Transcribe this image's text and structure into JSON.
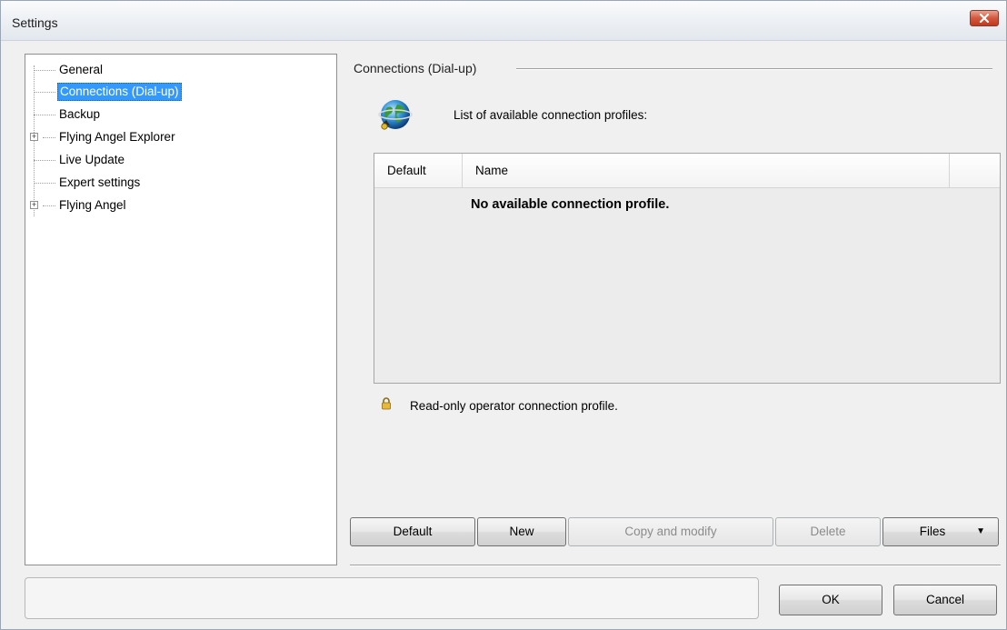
{
  "window": {
    "title": "Settings"
  },
  "tree": {
    "items": [
      {
        "label": "General",
        "selected": false,
        "expandable": false
      },
      {
        "label": "Connections (Dial-up)",
        "selected": true,
        "expandable": false
      },
      {
        "label": "Backup",
        "selected": false,
        "expandable": false
      },
      {
        "label": "Flying Angel Explorer",
        "selected": false,
        "expandable": true
      },
      {
        "label": "Live Update",
        "selected": false,
        "expandable": false
      },
      {
        "label": "Expert settings",
        "selected": false,
        "expandable": false
      },
      {
        "label": "Flying Angel",
        "selected": false,
        "expandable": true
      }
    ]
  },
  "panel": {
    "group_title": "Connections (Dial-up)",
    "list_caption": "List of available connection profiles:",
    "icon": "globe-network-icon",
    "columns": [
      "Default",
      "Name",
      ""
    ],
    "empty_message": "No available connection profile.",
    "legend_icon": "lock-icon",
    "legend_text": "Read-only operator connection profile."
  },
  "actions": {
    "default_label": "Default",
    "new_label": "New",
    "copy_label": "Copy and modify",
    "delete_label": "Delete",
    "files_label": "Files",
    "files_caret": "▼"
  },
  "footer": {
    "status_text": "",
    "ok_label": "OK",
    "cancel_label": "Cancel"
  },
  "colors": {
    "selection": "#3399ff",
    "close_button": "#c7462a"
  }
}
